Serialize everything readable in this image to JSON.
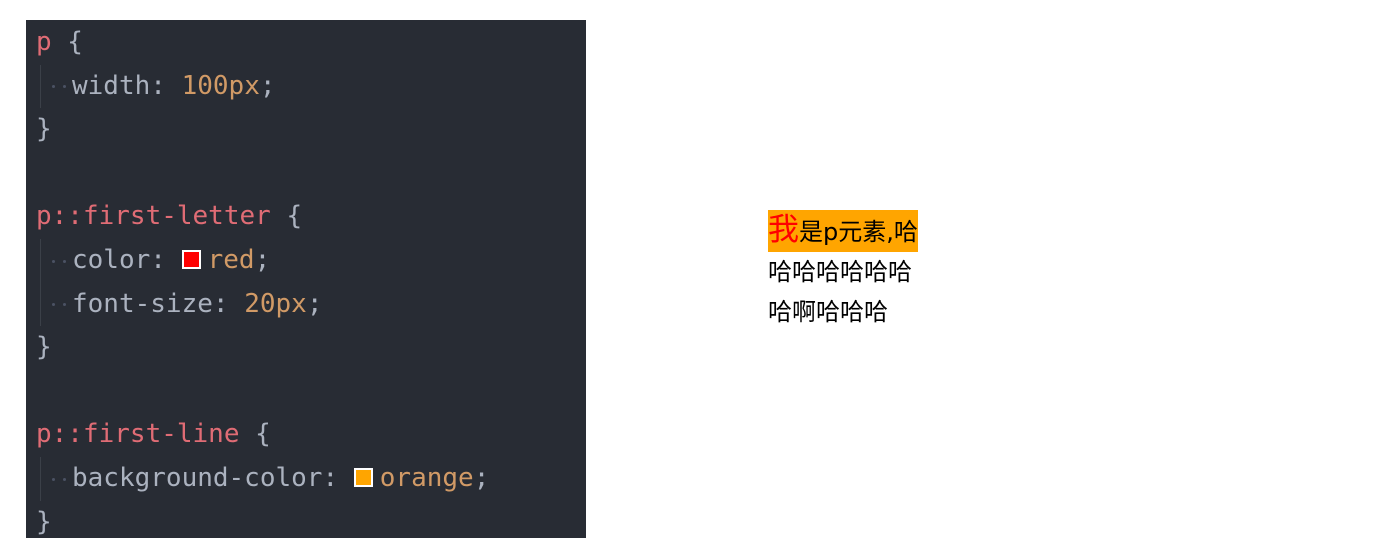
{
  "code": {
    "lines": [
      {
        "selector": "p",
        "brace": " {"
      },
      {
        "property": "width",
        "colon": ": ",
        "value": "100px",
        "semi": ";"
      },
      {
        "brace": "}"
      },
      {},
      {
        "selector": "p::first-letter",
        "brace": " {"
      },
      {
        "property": "color",
        "colon": ": ",
        "value": "red",
        "semi": ";"
      },
      {
        "property": "font-size",
        "colon": ": ",
        "value": "20px",
        "semi": ";"
      },
      {
        "brace": "}"
      },
      {},
      {
        "selector": "p::first-line",
        "brace": " {"
      },
      {
        "property": "background-color",
        "colon": ": ",
        "value": "orange",
        "semi": ";"
      },
      {
        "brace": "}"
      }
    ],
    "swatch_colors": {
      "red": "#ff0000",
      "orange": "#ffa500"
    }
  },
  "preview": {
    "first_letter": "我",
    "first_line_rest": "是p元素,哈",
    "line2": "哈哈哈哈哈哈",
    "line3": "哈啊哈哈哈",
    "first_letter_color": "#ff0000",
    "first_line_background": "#ffa500"
  }
}
